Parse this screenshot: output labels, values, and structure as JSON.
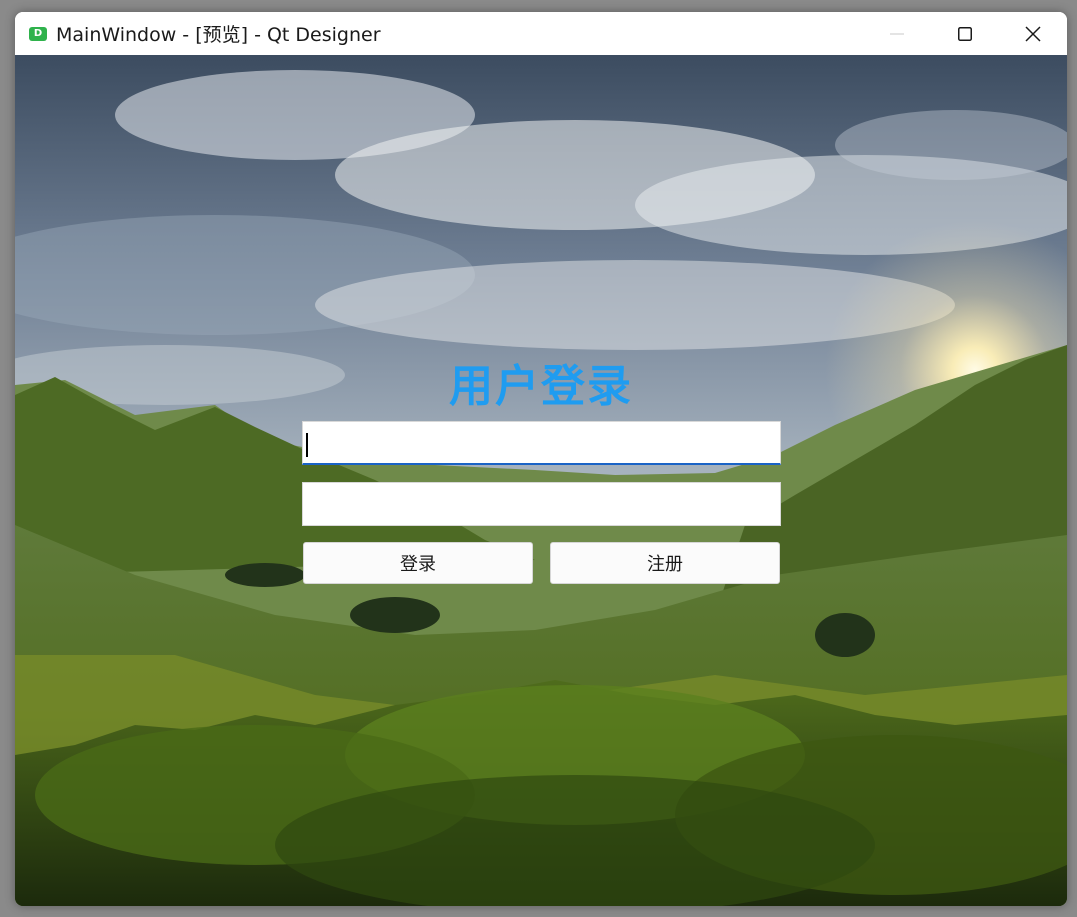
{
  "window": {
    "title": "MainWindow - [预览] - Qt Designer",
    "app_icon_letter": "D",
    "app_icon_color": "#2fb24c"
  },
  "login": {
    "heading": "用户登录",
    "heading_color": "#1f9cf0",
    "username_value": "",
    "password_value": "",
    "login_button": "登录",
    "register_button": "注册"
  },
  "icons": {
    "minimize": "minimize-icon",
    "maximize": "maximize-icon",
    "close": "close-icon"
  }
}
